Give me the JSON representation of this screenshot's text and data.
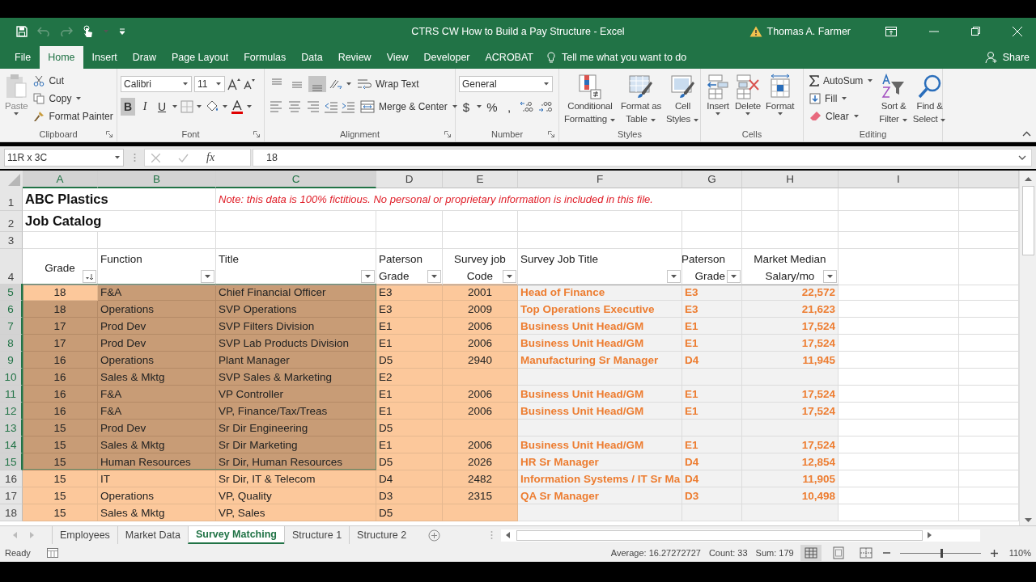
{
  "window": {
    "title": "CTRS CW How to Build a Pay Structure  -  Excel",
    "user": "Thomas A. Farmer"
  },
  "menu_tabs": [
    {
      "label": "File",
      "selected": false
    },
    {
      "label": "Home",
      "selected": true
    },
    {
      "label": "Insert",
      "selected": false
    },
    {
      "label": "Draw",
      "selected": false
    },
    {
      "label": "Page Layout",
      "selected": false
    },
    {
      "label": "Formulas",
      "selected": false
    },
    {
      "label": "Data",
      "selected": false
    },
    {
      "label": "Review",
      "selected": false
    },
    {
      "label": "View",
      "selected": false
    },
    {
      "label": "Developer",
      "selected": false
    },
    {
      "label": "ACROBAT",
      "selected": false
    }
  ],
  "tell_me": {
    "placeholder": "Tell me what you want to do"
  },
  "share": "Share",
  "ribbon": {
    "clipboard": {
      "label": "Clipboard",
      "paste": "Paste",
      "cut": "Cut",
      "copy": "Copy",
      "format_painter": "Format Painter"
    },
    "font": {
      "label": "Font",
      "name": "Calibri",
      "size": "11",
      "bold": {
        "label": "B",
        "on": true
      },
      "italic": {
        "label": "I",
        "on": false
      },
      "underline": {
        "label": "U",
        "on": false
      }
    },
    "alignment": {
      "label": "Alignment",
      "vertical": [
        {
          "selected": false
        },
        {
          "selected": false
        },
        {
          "selected": true
        }
      ],
      "wrap_text": "Wrap Text",
      "merge_center": "Merge & Center"
    },
    "number": {
      "label": "Number",
      "format": "General",
      "currency": "$",
      "percent": "%",
      "comma": ","
    },
    "styles": {
      "label": "Styles",
      "items": [
        {
          "lines": [
            "Conditional",
            "Formatting"
          ]
        },
        {
          "lines": [
            "Format as",
            "Table"
          ]
        },
        {
          "lines": [
            "Cell",
            "Styles"
          ]
        }
      ]
    },
    "cells": {
      "label": "Cells",
      "items": [
        "Insert",
        "Delete",
        "Format"
      ]
    },
    "editing": {
      "label": "Editing",
      "autosum": "AutoSum",
      "fill": "Fill",
      "clear": "Clear",
      "sort_filter": [
        "Sort &",
        "Filter"
      ],
      "find_select": [
        "Find &",
        "Select"
      ]
    }
  },
  "formula_bar": {
    "name_box": "11R x 3C",
    "function_label": "fx",
    "value": "18"
  },
  "sheet": {
    "columns": [
      {
        "label": "A",
        "selected": true
      },
      {
        "label": "B",
        "selected": true
      },
      {
        "label": "C",
        "selected": true
      },
      {
        "label": "D",
        "selected": false
      },
      {
        "label": "E",
        "selected": false
      },
      {
        "label": "F",
        "selected": false
      },
      {
        "label": "G",
        "selected": false
      },
      {
        "label": "H",
        "selected": false
      },
      {
        "label": "I",
        "selected": false
      }
    ],
    "title_rows": [
      {
        "number": "1",
        "title": "ABC Plastics",
        "note": "Note: this data is 100% fictitious. No personal or proprietary information is included in this file."
      },
      {
        "number": "2",
        "title": "Job Catalog"
      },
      {
        "number": "3"
      }
    ],
    "header_row": {
      "number": "4",
      "cells": [
        {
          "lines": [
            "Grade"
          ],
          "sorted": true
        },
        {
          "lines": [
            "Function"
          ],
          "sorted": false
        },
        {
          "lines": [
            "Title"
          ],
          "sorted": false
        },
        {
          "lines": [
            "Paterson",
            "Grade"
          ],
          "sorted": false
        },
        {
          "lines": [
            "Survey job",
            "Code"
          ],
          "sorted": false
        },
        {
          "lines": [
            "Survey Job Title"
          ],
          "sorted": false
        },
        {
          "lines": [
            "Paterson",
            "Grade"
          ],
          "sorted": false
        },
        {
          "lines": [
            "Market Median",
            "Salary/mo"
          ],
          "sorted": false
        }
      ]
    },
    "rows": [
      {
        "number": "5",
        "selected": true,
        "grade": "18",
        "function": "F&A",
        "title": "Chief Financial Officer",
        "paterson": "E3",
        "code": "2001",
        "survey_title": "Head of Finance",
        "survey_grade": "E3",
        "salary": "22,572"
      },
      {
        "number": "6",
        "selected": true,
        "grade": "18",
        "function": "Operations",
        "title": "SVP Operations",
        "paterson": "E3",
        "code": "2009",
        "survey_title": "Top Operations Executive",
        "survey_grade": "E3",
        "salary": "21,623"
      },
      {
        "number": "7",
        "selected": true,
        "grade": "17",
        "function": "Prod Dev",
        "title": "SVP Filters Division",
        "paterson": "E1",
        "code": "2006",
        "survey_title": "Business Unit Head/GM",
        "survey_grade": "E1",
        "salary": "17,524"
      },
      {
        "number": "8",
        "selected": true,
        "grade": "17",
        "function": "Prod Dev",
        "title": "SVP Lab Products Division",
        "paterson": "E1",
        "code": "2006",
        "survey_title": "Business Unit Head/GM",
        "survey_grade": "E1",
        "salary": "17,524"
      },
      {
        "number": "9",
        "selected": true,
        "grade": "16",
        "function": "Operations",
        "title": "Plant Manager",
        "paterson": "D5",
        "code": "2940",
        "survey_title": "Manufacturing Sr Manager",
        "survey_grade": "D4",
        "salary": "11,945"
      },
      {
        "number": "10",
        "selected": true,
        "grade": "16",
        "function": "Sales & Mktg",
        "title": "SVP Sales & Marketing",
        "paterson": "E2"
      },
      {
        "number": "11",
        "selected": true,
        "grade": "16",
        "function": "F&A",
        "title": "VP Controller",
        "paterson": "E1",
        "code": "2006",
        "survey_title": "Business Unit Head/GM",
        "survey_grade": "E1",
        "salary": "17,524"
      },
      {
        "number": "12",
        "selected": true,
        "grade": "16",
        "function": "F&A",
        "title": "VP, Finance/Tax/Treas",
        "paterson": "E1",
        "code": "2006",
        "survey_title": "Business Unit Head/GM",
        "survey_grade": "E1",
        "salary": "17,524"
      },
      {
        "number": "13",
        "selected": true,
        "grade": "15",
        "function": "Prod Dev",
        "title": "Sr Dir Engineering",
        "paterson": "D5"
      },
      {
        "number": "14",
        "selected": true,
        "grade": "15",
        "function": "Sales & Mktg",
        "title": "Sr Dir Marketing",
        "paterson": "E1",
        "code": "2006",
        "survey_title": "Business Unit Head/GM",
        "survey_grade": "E1",
        "salary": "17,524"
      },
      {
        "number": "15",
        "selected": true,
        "grade": "15",
        "function": "Human Resources",
        "title": "Sr Dir, Human Resources",
        "paterson": "D5",
        "code": "2026",
        "survey_title": "HR Sr Manager",
        "survey_grade": "D4",
        "salary": "12,854"
      },
      {
        "number": "16",
        "selected": false,
        "grade": "15",
        "function": "IT",
        "title": "Sr Dir, IT & Telecom",
        "paterson": "D4",
        "code": "2482",
        "survey_title": "Information Systems / IT Sr Ma",
        "survey_grade": "D4",
        "salary": "11,905"
      },
      {
        "number": "17",
        "selected": false,
        "grade": "15",
        "function": "Operations",
        "title": "VP, Quality",
        "paterson": "D3",
        "code": "2315",
        "survey_title": "QA Sr Manager",
        "survey_grade": "D3",
        "salary": "10,498"
      },
      {
        "number": "18",
        "selected": false,
        "grade": "15",
        "function": "Sales & Mktg",
        "title": "VP, Sales",
        "paterson": "D5"
      }
    ]
  },
  "sheet_tabs": [
    {
      "label": "Employees",
      "selected": false
    },
    {
      "label": "Market Data",
      "selected": false
    },
    {
      "label": "Survey Matching",
      "selected": true
    },
    {
      "label": "Structure 1",
      "selected": false
    },
    {
      "label": "Structure 2",
      "selected": false
    }
  ],
  "status_bar": {
    "mode": "Ready",
    "average": "Average: 16.27272727",
    "count": "Count: 33",
    "sum": "Sum: 179",
    "zoom": "110%",
    "zoom_slider": {
      "level": 0.52
    }
  }
}
